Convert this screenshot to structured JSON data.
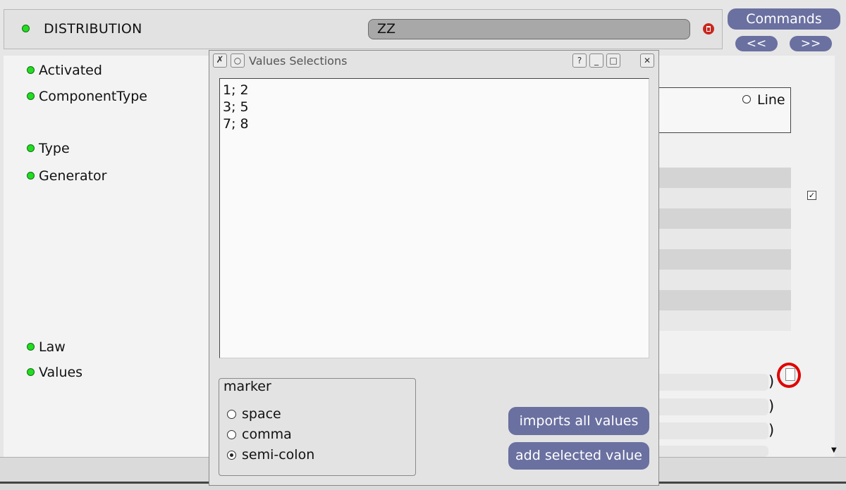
{
  "header": {
    "title": "DISTRIBUTION",
    "name_value": "ZZ",
    "commands_label": "Commands",
    "prev_label": "<<",
    "next_label": ">>"
  },
  "fields": [
    {
      "label": "Activated"
    },
    {
      "label": "ComponentType"
    },
    {
      "label": "Type"
    },
    {
      "label": "Generator"
    },
    {
      "label": "Law"
    },
    {
      "label": "Values"
    }
  ],
  "background": {
    "line_option": "Line"
  },
  "dialog": {
    "title": "Values Selections",
    "values": [
      "1; 2",
      "3; 5",
      "7; 8"
    ],
    "marker_label": "marker",
    "marker_options": [
      "space",
      "comma",
      "semi-colon"
    ],
    "selected_marker": "semi-colon",
    "imports_label": "imports all values",
    "add_label": "add selected value",
    "help_glyph": "?",
    "minimize_glyph": "_",
    "maximize_glyph": "□",
    "close_glyph": "✕"
  },
  "colors": {
    "accent_button": "#6a70a0",
    "status_dot": "#22dd22",
    "highlight_ring": "#e00000"
  }
}
